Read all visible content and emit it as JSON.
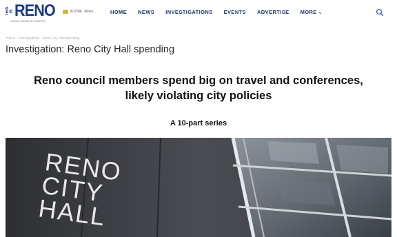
{
  "header": {
    "logo": {
      "prefix": "THIS IS",
      "name": "RENO",
      "tagline": "LOCAL NEWS & EVENTS"
    },
    "partner": {
      "label": "KUNR",
      "sub": "News"
    },
    "nav": [
      {
        "label": "HOME"
      },
      {
        "label": "NEWS"
      },
      {
        "label": "INVESTIGATIONS"
      },
      {
        "label": "EVENTS"
      },
      {
        "label": "ADVERTISE"
      },
      {
        "label": "MORE"
      }
    ],
    "search_icon": "search-icon"
  },
  "breadcrumb": "Home › Investigations › Reno City Hall spending",
  "kicker": "Investigation: Reno City Hall spending",
  "article": {
    "headline_line1": "Reno council members spend big on travel and conferences,",
    "headline_line2": "likely violating city policies",
    "series": "A 10-part series"
  },
  "hero": {
    "sign_line1": "RENO",
    "sign_line2": "CITY",
    "sign_line3": "HALL"
  },
  "colors": {
    "brand": "#1a3a8a",
    "nav": "#1a2f6b",
    "search": "#3b5bd6"
  }
}
